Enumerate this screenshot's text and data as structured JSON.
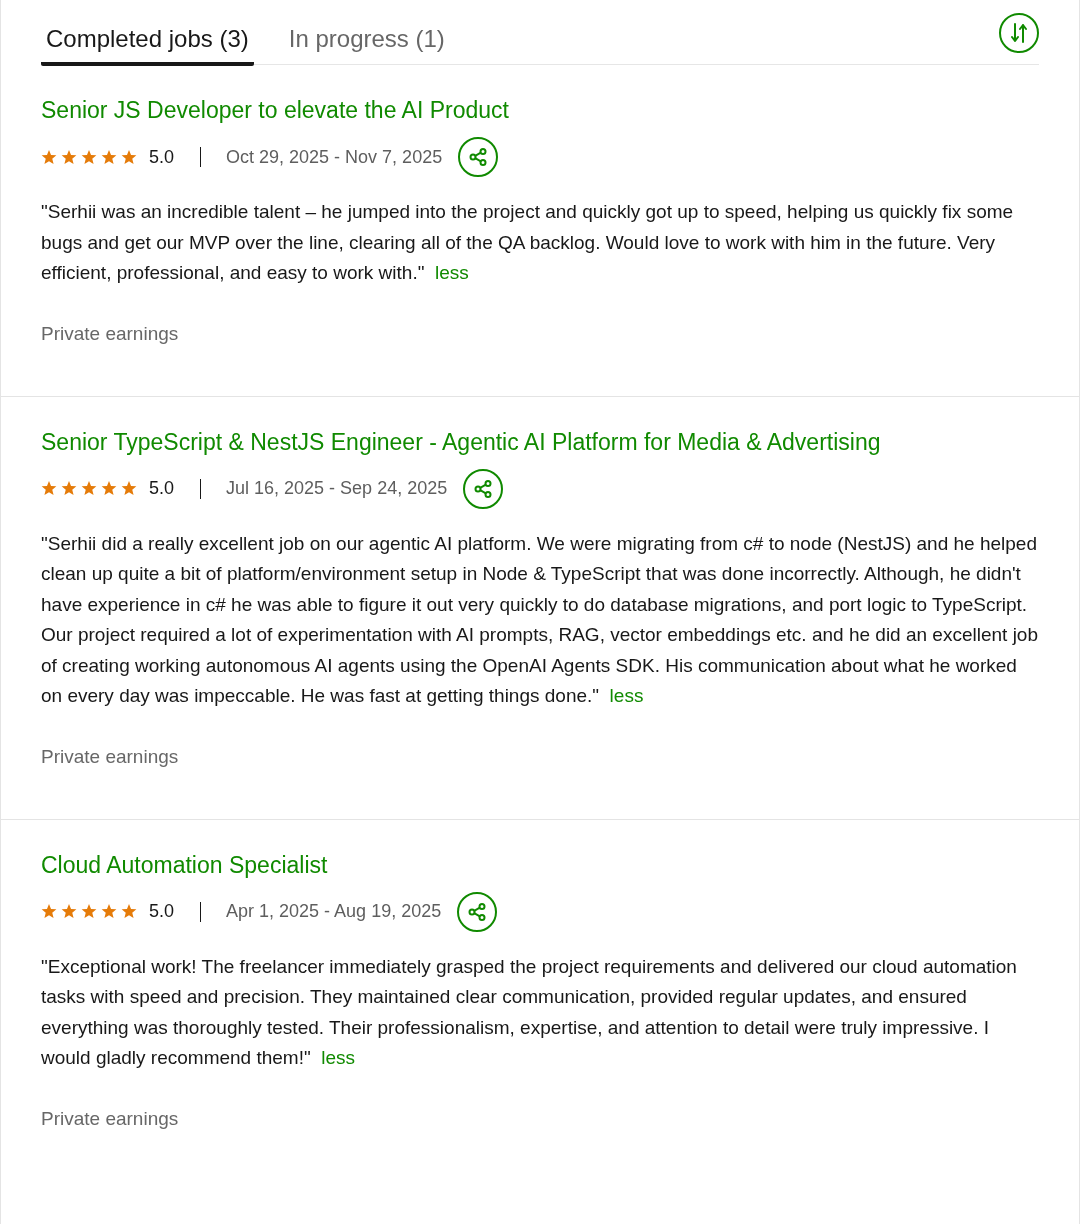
{
  "tabs": [
    {
      "label": "Completed jobs (3)",
      "selected": true
    },
    {
      "label": "In progress (1)",
      "selected": false
    }
  ],
  "jobs": [
    {
      "title": "Senior JS Developer to elevate the AI Product",
      "stars": 5,
      "rating": "5.0",
      "dates": "Oct 29, 2025 - Nov 7, 2025",
      "review": "\"Serhii was an incredible talent – he jumped into the project and quickly got up to speed, helping us quickly fix some bugs and get our MVP over the line, clearing all of the QA backlog. Would love to work with him in the future. Very efficient, professional, and easy to work with.\"",
      "toggle": "less",
      "earnings": "Private earnings"
    },
    {
      "title": "Senior TypeScript & NestJS Engineer - Agentic AI Platform for Media & Advertising",
      "stars": 5,
      "rating": "5.0",
      "dates": "Jul 16, 2025 - Sep 24, 2025",
      "review": "\"Serhii did a really excellent job on our agentic AI platform. We were migrating from c# to node (NestJS) and he helped clean up quite a bit of platform/environment setup in Node & TypeScript that was done incorrectly. Although, he didn't have experience in c# he was able to figure it out very quickly to do database migrations, and port logic to TypeScript. Our project required a lot of experimentation with AI prompts, RAG, vector embeddings etc. and he did an excellent job of creating working autonomous AI agents using the OpenAI Agents SDK. His communication about what he worked on every day was impeccable. He was fast at getting things done.\"",
      "toggle": "less",
      "earnings": "Private earnings"
    },
    {
      "title": "Cloud Automation Specialist",
      "stars": 5,
      "rating": "5.0",
      "dates": "Apr 1, 2025 - Aug 19, 2025",
      "review": "\"Exceptional work! The freelancer immediately grasped the project requirements and delivered our cloud automation tasks with speed and precision. They maintained clear communication, provided regular updates, and ensured everything was thoroughly tested. Their professionalism, expertise, and attention to detail were truly impressive. I would gladly recommend them!\"",
      "toggle": "less",
      "earnings": "Private earnings"
    }
  ]
}
